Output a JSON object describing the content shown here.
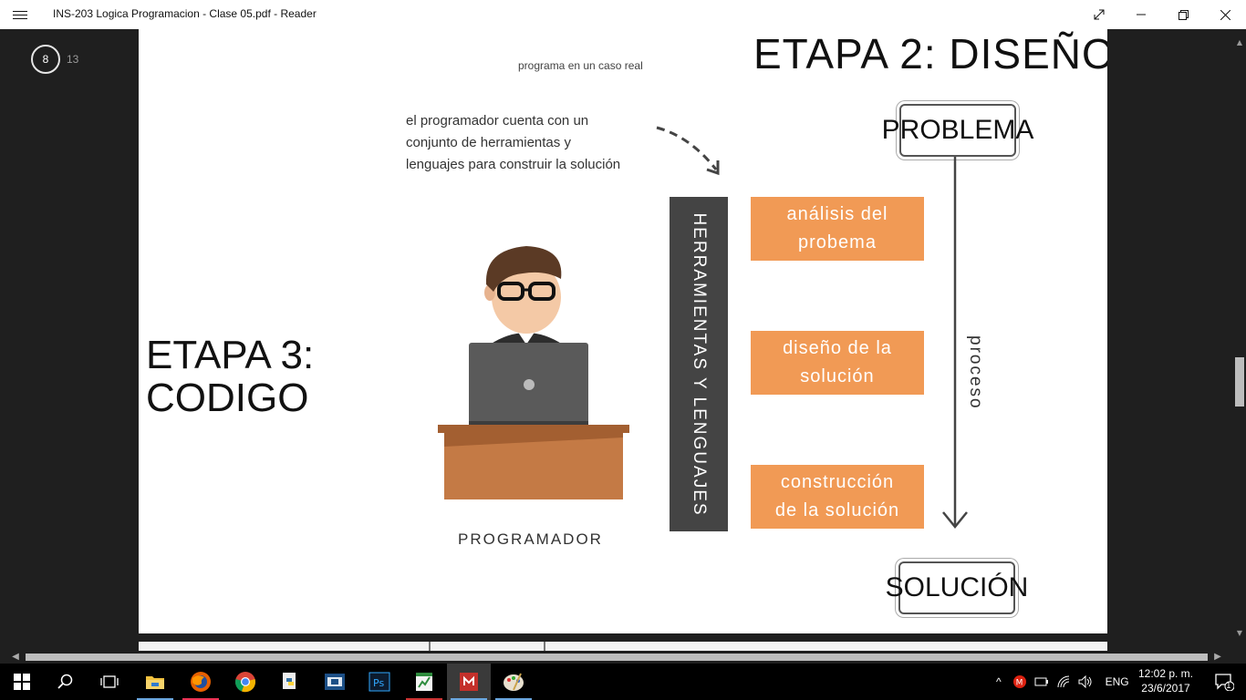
{
  "window": {
    "title": "INS-203 Logica Programacion - Clase 05.pdf - Reader"
  },
  "pager": {
    "current": "8",
    "total": "13"
  },
  "prev_page": {
    "caption": "programa en un caso real",
    "title": "ETAPA 2: DISEÑO"
  },
  "slide": {
    "stage_title_line1": "ETAPA 3:",
    "stage_title_line2": "CODIGO",
    "note_line1": "el programador cuenta con un",
    "note_line2": "conjunto de herramientas y",
    "note_line3": "lenguajes para construir la solución",
    "programmer_label": "PROGRAMADOR",
    "tools_label": "HERRAMIENTAS Y LENGUAJES",
    "steps": [
      {
        "line1": "análisis del",
        "line2": "probema"
      },
      {
        "line1": "diseño de la",
        "line2": "solución"
      },
      {
        "line1": "construcción",
        "line2": "de la solución"
      }
    ],
    "problem_label": "PROBLEMA",
    "process_label": "proceso",
    "solution_label": "SOLUCIÓN",
    "colors": {
      "step_orange": "#f19a55",
      "tools_bar": "#444444",
      "desk": "#c47a45",
      "laptop": "#5a5a5a"
    }
  },
  "zoom": {
    "minus": "−",
    "plus": "+"
  },
  "taskbar": {
    "language": "ENG",
    "time": "12:02 p. m.",
    "date": "23/6/2017",
    "notification_count": "1",
    "apps": [
      "start-icon",
      "search-icon",
      "task-view-icon",
      "file-explorer-icon",
      "firefox-icon",
      "chrome-icon",
      "python-icon",
      "video-icon",
      "photoshop-icon",
      "spreadsheet-icon",
      "reader-icon",
      "paint-icon"
    ]
  }
}
